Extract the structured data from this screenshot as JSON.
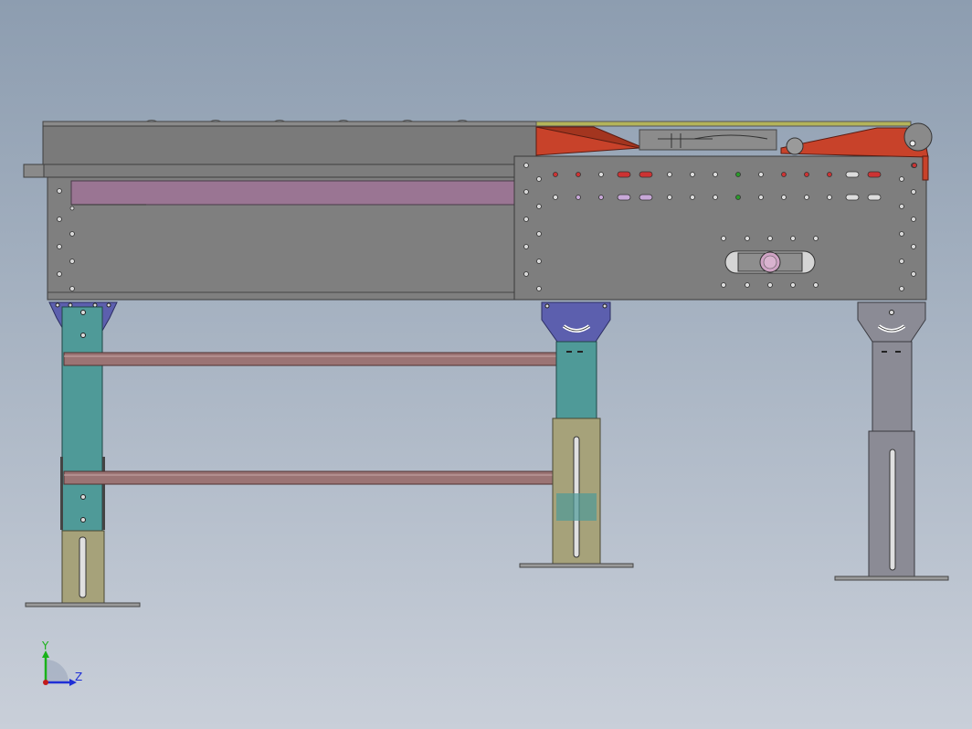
{
  "viewport": {
    "background_top": "#8d9db0",
    "background_bottom": "#c9cfd9"
  },
  "triad": {
    "y_label": "Y",
    "z_label": "Z",
    "y_color": "#19b219",
    "z_color": "#1f2fd6",
    "origin_color": "#c21b1b"
  },
  "colors": {
    "frame_gray": "#7e7e7e",
    "frame_dark": "#5a5a5a",
    "pink_rail": "#9c7494",
    "red_guard": "#c8422a",
    "teal_leg": "#4f9a98",
    "olive_sleeve": "#a6a27a",
    "gray_leg": "#8b8b95",
    "blue_bracket": "#5c5fae",
    "brace_pink": "#9b7474",
    "plate": "#9a9a9a"
  }
}
